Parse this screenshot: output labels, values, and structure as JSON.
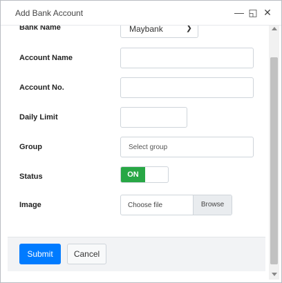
{
  "window": {
    "title": "Add Bank Account"
  },
  "form": {
    "bank_name": {
      "label": "Bank Name",
      "value": "Maybank"
    },
    "account_name": {
      "label": "Account Name",
      "value": ""
    },
    "account_no": {
      "label": "Account No.",
      "value": ""
    },
    "daily_limit": {
      "label": "Daily Limit",
      "value": ""
    },
    "group": {
      "label": "Group",
      "placeholder": "Select group"
    },
    "status": {
      "label": "Status",
      "value": "ON"
    },
    "image": {
      "label": "Image",
      "file_text": "Choose file",
      "browse_label": "Browse"
    }
  },
  "footer": {
    "submit_label": "Submit",
    "cancel_label": "Cancel"
  },
  "colors": {
    "submit": "#007bff",
    "toggle_on": "#28a745"
  }
}
